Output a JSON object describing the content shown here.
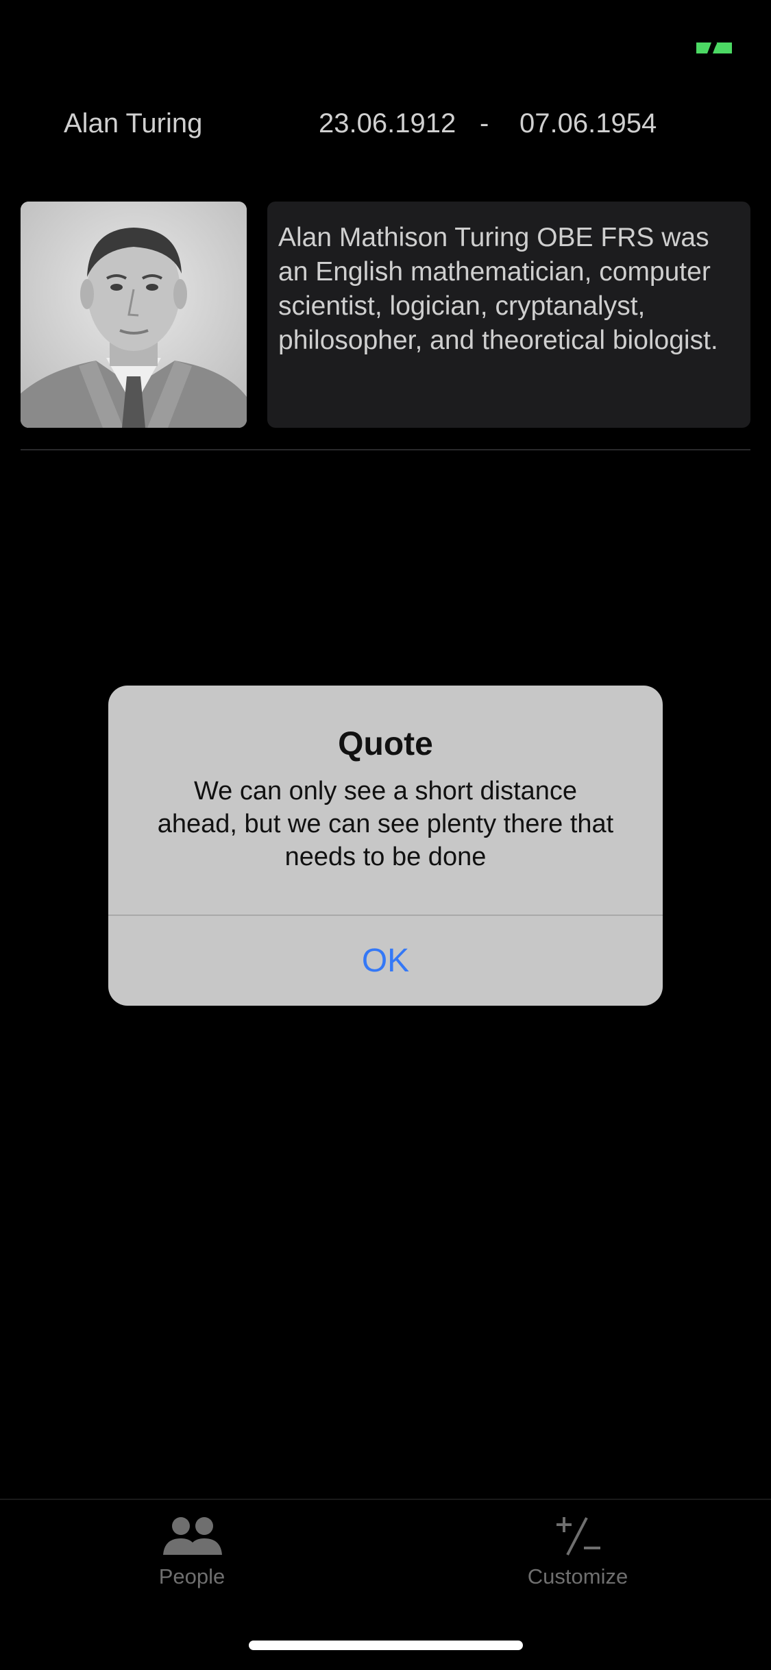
{
  "person": {
    "name": "Alan Turing",
    "born": "23.06.1912",
    "separator": "-",
    "died": "07.06.1954",
    "bio": "Alan Mathison Turing OBE FRS was an English mathematician, computer scientist, logician, cryptanalyst, philosopher, and theoretical biologist."
  },
  "alert": {
    "title": "Quote",
    "message": "We can only see a short distance ahead, but we can see plenty there that needs to be done",
    "ok_label": "OK"
  },
  "tabbar": {
    "items": [
      {
        "label": "People",
        "icon": "people-icon"
      },
      {
        "label": "Customize",
        "icon": "plus-minus-icon"
      }
    ]
  },
  "colors": {
    "background": "#000000",
    "card": "#1c1c1e",
    "alert_bg": "#c7c7c7",
    "accent": "#3478f6",
    "status_green": "#4cd964"
  }
}
